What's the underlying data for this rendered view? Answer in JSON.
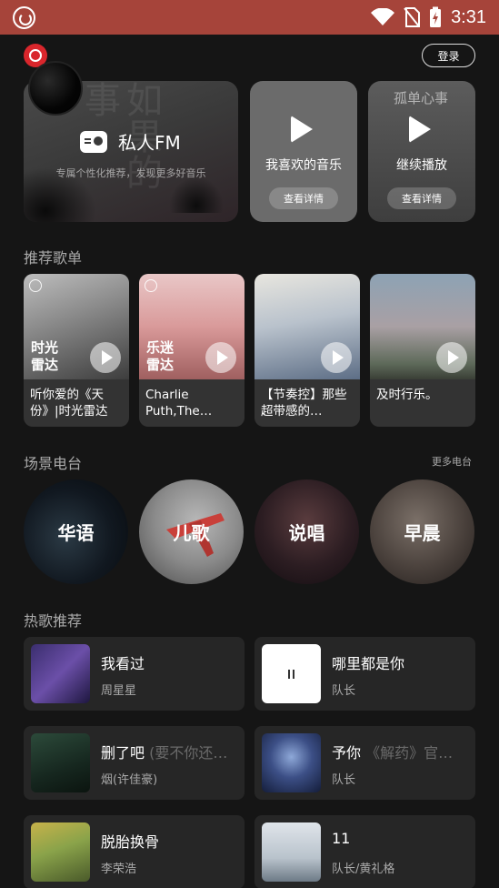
{
  "status_bar": {
    "time": "3:31"
  },
  "header": {
    "login_label": "登录"
  },
  "top_cards": {
    "fm": {
      "title": "私人FM",
      "subtitle": "专属个性化推荐，发现更多好音乐",
      "bg_text": "如果的事"
    },
    "favorite": {
      "label": "我喜欢的音乐",
      "button": "查看详情"
    },
    "continue": {
      "label": "继续播放",
      "button": "查看详情",
      "bg_text": "孤单心事"
    }
  },
  "playlists_section": {
    "title": "推荐歌单",
    "items": [
      {
        "tag": "时光雷达",
        "name": "听你爱的《天份》|时光雷达"
      },
      {
        "tag": "乐迷雷达",
        "name": "Charlie Puth,The…"
      },
      {
        "tag": "",
        "name": "【节奏控】那些超带感的…"
      },
      {
        "tag": "",
        "name": "及时行乐。"
      }
    ]
  },
  "scene_section": {
    "title": "场景电台",
    "more": "更多电台",
    "items": [
      {
        "label": "华语"
      },
      {
        "label": "儿歌"
      },
      {
        "label": "说唱"
      },
      {
        "label": "早晨"
      }
    ]
  },
  "hot_section": {
    "title": "热歌推荐",
    "songs": [
      {
        "title": "我看过",
        "title_aux": "",
        "artist": "周星星"
      },
      {
        "title": "哪里都是你",
        "title_aux": "",
        "artist": "队长"
      },
      {
        "title": "删了吧",
        "title_aux": " (要不你还…",
        "artist": "烟(许佳豪)"
      },
      {
        "title": "予你",
        "title_aux": " 《解药》官…",
        "artist": "队长"
      },
      {
        "title": "脱胎换骨",
        "title_aux": "",
        "artist": "李荣浩"
      },
      {
        "title": "11",
        "title_aux": "",
        "artist": "队长/黄礼格"
      }
    ]
  }
}
